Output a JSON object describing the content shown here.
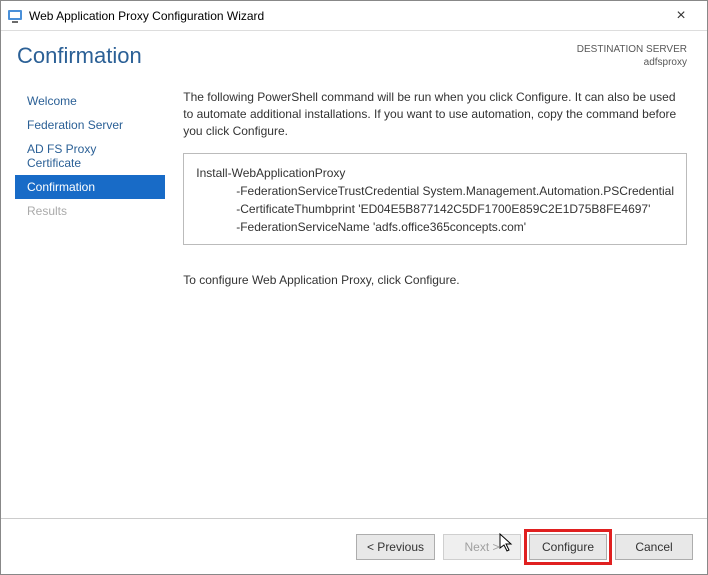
{
  "window": {
    "title": "Web Application Proxy Configuration Wizard"
  },
  "header": {
    "heading": "Confirmation",
    "destination_label": "DESTINATION SERVER",
    "destination_value": "adfsproxy"
  },
  "sidebar": {
    "items": [
      {
        "label": "Welcome",
        "state": "normal"
      },
      {
        "label": "Federation Server",
        "state": "normal"
      },
      {
        "label": "AD FS Proxy Certificate",
        "state": "normal"
      },
      {
        "label": "Confirmation",
        "state": "active"
      },
      {
        "label": "Results",
        "state": "disabled"
      }
    ]
  },
  "main": {
    "intro": "The following PowerShell command will be run when you click Configure. It can also be used to automate additional installations. If you want to use automation, copy the command before you click Configure.",
    "ps_command": "Install-WebApplicationProxy",
    "ps_params": [
      "-FederationServiceTrustCredential System.Management.Automation.PSCredential",
      "-CertificateThumbprint 'ED04E5B877142C5DF1700E859C2E1D75B8FE4697'",
      "-FederationServiceName 'adfs.office365concepts.com'"
    ],
    "postnote": "To configure Web Application Proxy, click Configure."
  },
  "footer": {
    "previous": "< Previous",
    "next": "Next >",
    "configure": "Configure",
    "cancel": "Cancel"
  }
}
